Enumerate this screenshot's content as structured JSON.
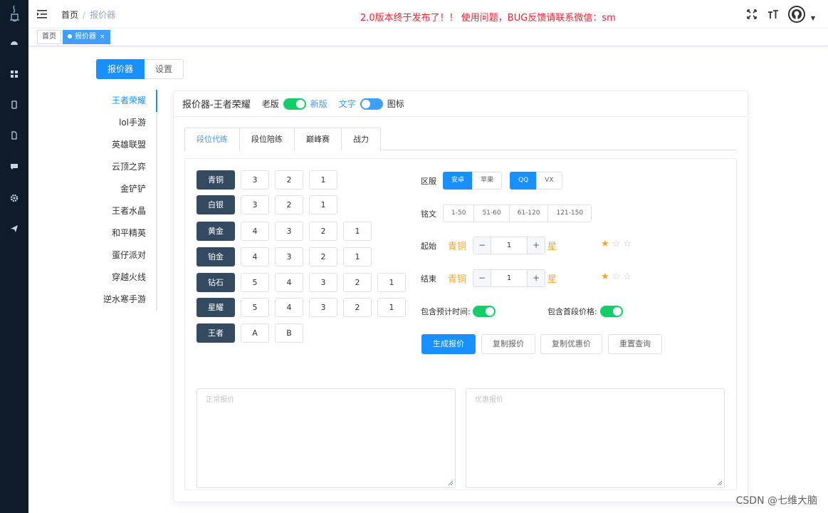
{
  "header": {
    "breadcrumb": {
      "home": "首页",
      "separator": "/",
      "current": "报价器"
    },
    "notice": "2.0版本终于发布了！！ 使用问题，BUG反馈请联系微信：sm"
  },
  "tags": [
    {
      "label": "首页"
    },
    {
      "label": "报价器",
      "close": "×"
    }
  ],
  "mode_tabs": [
    "报价器",
    "设置"
  ],
  "games": [
    "王者荣耀",
    "lol手游",
    "英雄联盟",
    "云顶之弈",
    "金铲铲",
    "王者水晶",
    "和平精英",
    "蛋仔派对",
    "穿越火线",
    "逆水寒手游"
  ],
  "card": {
    "title": "报价器-王者荣耀",
    "switch1_left": "老版",
    "switch1_right": "新版",
    "switch2_left": "文字",
    "switch2_right": "图标"
  },
  "panel_tabs": [
    "段位代练",
    "段位陪练",
    "巅峰赛",
    "战力"
  ],
  "ranks": [
    {
      "name": "青铜",
      "stars": [
        "3",
        "2",
        "1"
      ]
    },
    {
      "name": "白银",
      "stars": [
        "3",
        "2",
        "1"
      ]
    },
    {
      "name": "黄金",
      "stars": [
        "4",
        "3",
        "2",
        "1"
      ]
    },
    {
      "name": "铂金",
      "stars": [
        "4",
        "3",
        "2",
        "1"
      ]
    },
    {
      "name": "钻石",
      "stars": [
        "5",
        "4",
        "3",
        "2",
        "1"
      ]
    },
    {
      "name": "星耀",
      "stars": [
        "5",
        "4",
        "3",
        "2",
        "1"
      ]
    },
    {
      "name": "王者",
      "stars": [
        "A",
        "B"
      ]
    }
  ],
  "form": {
    "server_label": "区服",
    "platform_options": [
      "安卓",
      "苹果"
    ],
    "account_options": [
      "QQ",
      "VX"
    ],
    "inscription_label": "铭文",
    "inscription_options": [
      "1-50",
      "51-60",
      "61-120",
      "121-150"
    ],
    "start_label": "起始",
    "start_rank": "青铜",
    "start_value": "1",
    "end_label": "结束",
    "end_rank": "青铜",
    "end_value": "1",
    "star_label": "星",
    "stepper_minus": "−",
    "stepper_plus": "+",
    "start_rating": 1,
    "end_rating": 1,
    "toggle1_label": "包含预计时间:",
    "toggle2_label": "包含首段价格:"
  },
  "buttons": {
    "generate": "生成报价",
    "copy": "复制报价",
    "copy_discount": "复制优惠价",
    "reset": "重置查询"
  },
  "textareas": {
    "normal_placeholder": "正常报价",
    "discount_placeholder": "优惠报价"
  },
  "watermark": "CSDN @七维大脑",
  "colors": {
    "primary": "#1890ff",
    "switch_on": "#13ce66",
    "rank_bg": "#344a61",
    "notice": "#f5222d",
    "star": "#f5a623"
  }
}
